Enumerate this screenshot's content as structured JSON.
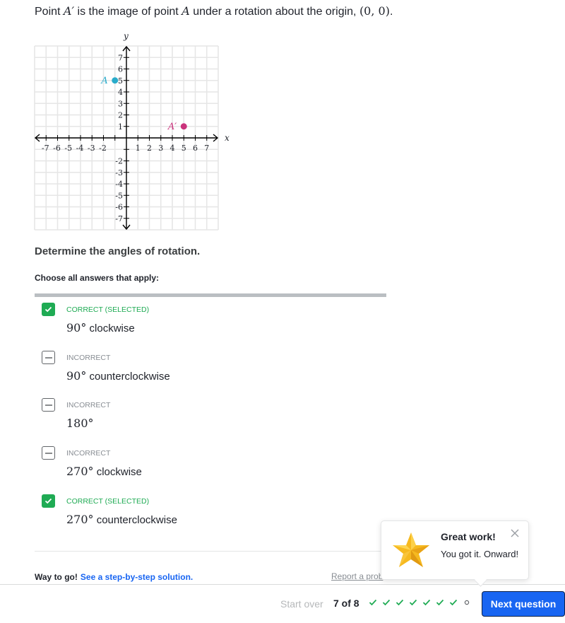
{
  "prompt": {
    "before": "Point ",
    "point_image": "A′",
    "middle": " is the image of point ",
    "point": "A",
    "after": " under a rotation about the origin, ",
    "origin": "(0, 0)",
    "end": "."
  },
  "graph": {
    "x_label": "x",
    "y_label": "y",
    "range": [
      -8,
      8
    ],
    "tick_labels_x": [
      "-7",
      "-6",
      "-5",
      "-4",
      "-3",
      "-2",
      "1",
      "2",
      "3",
      "4",
      "5",
      "6",
      "7"
    ],
    "tick_labels_y": [
      "7",
      "6",
      "5",
      "4",
      "3",
      "2",
      "1",
      "-2",
      "-3",
      "-4",
      "-5",
      "-6",
      "-7"
    ],
    "points": [
      {
        "label": "A",
        "x": -1,
        "y": 5,
        "color": "#29abca"
      },
      {
        "label": "A′",
        "x": 5,
        "y": 1,
        "color": "#ca337c"
      }
    ]
  },
  "question": {
    "subquestion": "Determine the angles of rotation.",
    "instruction": "Choose all answers that apply:"
  },
  "choices": [
    {
      "status": "CORRECT (SELECTED)",
      "state": "correct",
      "angle": "90°",
      "direction": " clockwise"
    },
    {
      "status": "INCORRECT",
      "state": "incorrect",
      "angle": "90°",
      "direction": " counterclockwise"
    },
    {
      "status": "INCORRECT",
      "state": "incorrect",
      "angle": "180°",
      "direction": ""
    },
    {
      "status": "INCORRECT",
      "state": "incorrect",
      "angle": "270°",
      "direction": " clockwise"
    },
    {
      "status": "CORRECT (SELECTED)",
      "state": "correct",
      "angle": "270°",
      "direction": " counterclockwise"
    }
  ],
  "footer": {
    "praise": "Way to go!",
    "solution_link": "See a step-by-step solution.",
    "report_link": "Report a prob"
  },
  "toast": {
    "title": "Great work!",
    "message": "You got it. Onward!"
  },
  "bottom_bar": {
    "start_over": "Start over",
    "progress": "7 of 8",
    "progress_states": [
      "done",
      "done",
      "done",
      "done",
      "done",
      "done",
      "done",
      "pending"
    ],
    "next_button": "Next question"
  },
  "colors": {
    "accent": "#1865f2",
    "correct": "#1fab54",
    "point_A": "#29abca",
    "point_A_prime": "#ca337c"
  }
}
